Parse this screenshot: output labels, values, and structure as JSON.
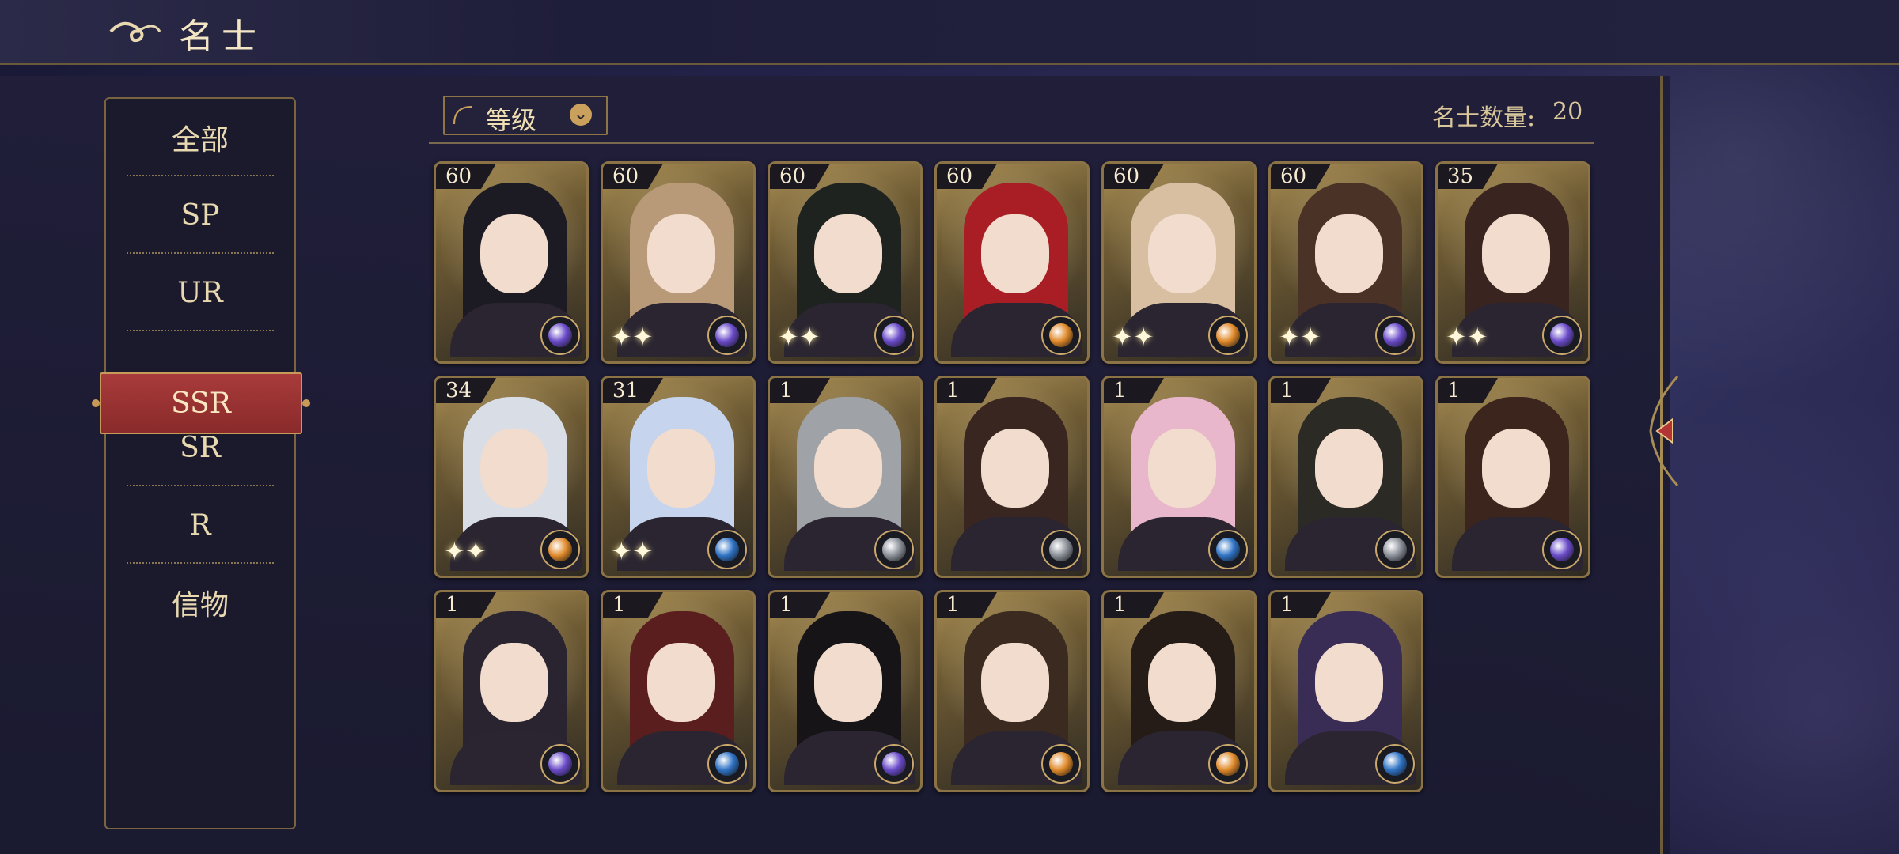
{
  "header": {
    "title": "名士"
  },
  "sidebar": {
    "items": [
      {
        "label": "全部",
        "active": false
      },
      {
        "label": "SP",
        "active": false
      },
      {
        "label": "UR",
        "active": false
      },
      {
        "label": "SSR",
        "active": true
      },
      {
        "label": "SR",
        "active": false
      },
      {
        "label": "R",
        "active": false
      },
      {
        "label": "信物",
        "active": false
      }
    ]
  },
  "toolbar": {
    "sort_label": "等级",
    "count_label": "名士数量:",
    "count_value": "20"
  },
  "colors": {
    "accent_red": "#9a3232",
    "gold": "#c9a15d"
  },
  "cards": [
    {
      "level": "60",
      "element": "purple",
      "hair": "#1c1a22",
      "sparkle": false
    },
    {
      "level": "60",
      "element": "purple",
      "hair": "#b89a78",
      "sparkle": true
    },
    {
      "level": "60",
      "element": "purple",
      "hair": "#1e2320",
      "sparkle": true
    },
    {
      "level": "60",
      "element": "orange",
      "hair": "#a81e24",
      "sparkle": false
    },
    {
      "level": "60",
      "element": "orange",
      "hair": "#d9bfa2",
      "sparkle": true
    },
    {
      "level": "60",
      "element": "purple",
      "hair": "#4a3226",
      "sparkle": true
    },
    {
      "level": "35",
      "element": "purple",
      "hair": "#3a2420",
      "sparkle": true
    },
    {
      "level": "34",
      "element": "orange",
      "hair": "#d8dde6",
      "sparkle": true
    },
    {
      "level": "31",
      "element": "blue",
      "hair": "#c6d4ee",
      "sparkle": true
    },
    {
      "level": "1",
      "element": "gray",
      "hair": "#9fa3a8",
      "sparkle": false
    },
    {
      "level": "1",
      "element": "gray",
      "hair": "#3a2620",
      "sparkle": false
    },
    {
      "level": "1",
      "element": "blue",
      "hair": "#e9b7cc",
      "sparkle": false
    },
    {
      "level": "1",
      "element": "gray",
      "hair": "#2b2a24",
      "sparkle": false
    },
    {
      "level": "1",
      "element": "purple",
      "hair": "#3b251c",
      "sparkle": false
    },
    {
      "level": "1",
      "element": "purple",
      "hair": "#2a2430",
      "sparkle": false
    },
    {
      "level": "1",
      "element": "blue",
      "hair": "#5a1e1e",
      "sparkle": false
    },
    {
      "level": "1",
      "element": "purple",
      "hair": "#161416",
      "sparkle": false
    },
    {
      "level": "1",
      "element": "orange",
      "hair": "#3b2a20",
      "sparkle": false
    },
    {
      "level": "1",
      "element": "orange",
      "hair": "#251c18",
      "sparkle": false
    },
    {
      "level": "1",
      "element": "blue",
      "hair": "#3a2d55",
      "sparkle": false
    }
  ]
}
